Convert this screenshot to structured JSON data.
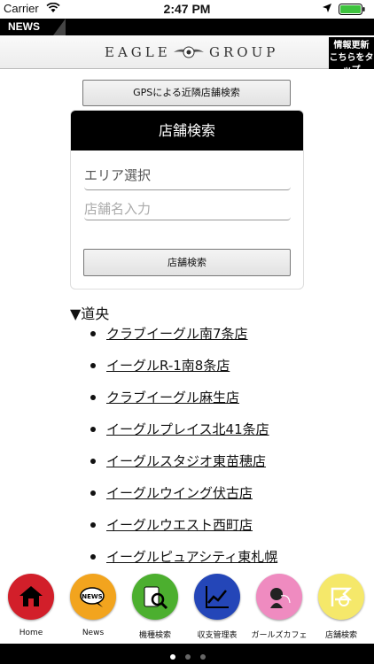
{
  "status_bar": {
    "carrier": "Carrier",
    "time": "2:47 PM"
  },
  "news_strip": {
    "label": "NEWS"
  },
  "logo": {
    "left": "EAGLE",
    "right": "GROUP"
  },
  "update_badge": {
    "line1": "情報更新",
    "line2": "こちらをタップ"
  },
  "gps_button": {
    "label": "GPSによる近隣店舗検索"
  },
  "search_card": {
    "title": "店舗検索",
    "area_field": "エリア選択",
    "name_placeholder": "店舗名入力",
    "search_button": "店舗検索"
  },
  "region": {
    "heading": "▼道央"
  },
  "stores": [
    "クラブイーグル南7条店",
    "イーグルR-1南8条店",
    "クラブイーグル麻生店",
    "イーグルプレイス北41条店",
    "イーグルスタジオ東苗穂店",
    "イーグルウイング伏古店",
    "イーグルウエスト西町店",
    "イーグルピュアシティ東札幌"
  ],
  "tabs": [
    {
      "label": "Home",
      "icon": "home-icon",
      "color": "#d21f2a"
    },
    {
      "label": "News",
      "icon": "news-icon",
      "color": "#f2a41e"
    },
    {
      "label": "機種検索",
      "icon": "machine-search-icon",
      "color": "#4caf2f"
    },
    {
      "label": "収支管理表",
      "icon": "chart-icon",
      "color": "#2446b8"
    },
    {
      "label": "ガールズカフェ",
      "icon": "girls-cafe-icon",
      "color": "#ef8bc0"
    },
    {
      "label": "店舗検索",
      "icon": "store-search-icon",
      "color": "#f5e86a"
    }
  ]
}
